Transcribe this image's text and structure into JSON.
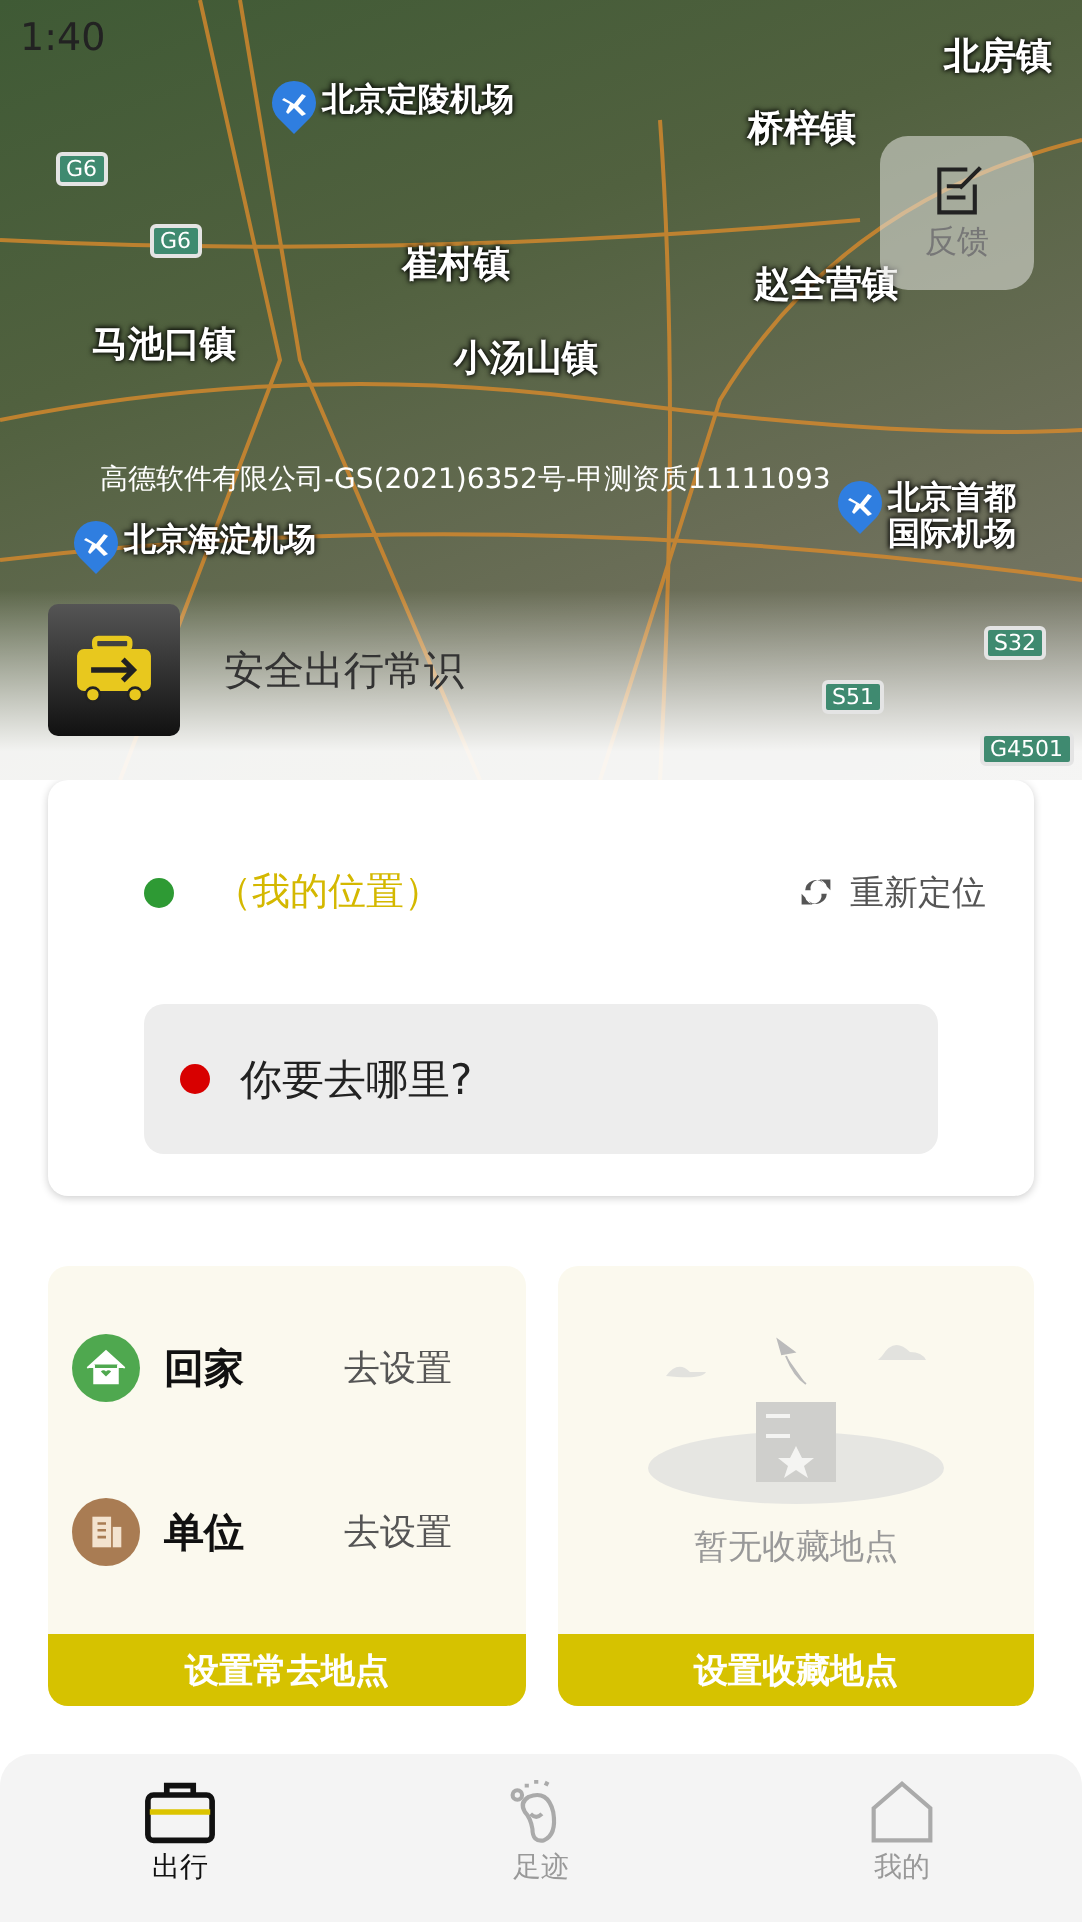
{
  "status_bar": {
    "time": "1:40"
  },
  "map": {
    "labels": [
      {
        "text": "北房镇",
        "kind": "place"
      },
      {
        "text": "北京定陵机场",
        "kind": "airport"
      },
      {
        "text": "桥梓镇",
        "kind": "place"
      },
      {
        "text": "G6",
        "kind": "road"
      },
      {
        "text": "G6",
        "kind": "road"
      },
      {
        "text": "崔村镇",
        "kind": "place"
      },
      {
        "text": "赵全营镇",
        "kind": "place"
      },
      {
        "text": "马池口镇",
        "kind": "place"
      },
      {
        "text": "小汤山镇",
        "kind": "place"
      },
      {
        "text": "北京海淀机场",
        "kind": "airport"
      },
      {
        "text": "北京首都国际机场",
        "kind": "airport"
      },
      {
        "text": "S32",
        "kind": "road"
      },
      {
        "text": "S51",
        "kind": "road"
      },
      {
        "text": "G4501",
        "kind": "road"
      }
    ],
    "copyright": "高德软件有限公司-GS(2021)6352号-甲测资质11111093"
  },
  "feedback_button": {
    "label": "反馈"
  },
  "safety_banner": {
    "label": "安全出行常识"
  },
  "route_card": {
    "origin": {
      "label": "（我的位置）",
      "color": "#2e9a34"
    },
    "relocate_button": {
      "label": "重新定位"
    },
    "destination": {
      "placeholder": "你要去哪里?",
      "color": "#d80000"
    }
  },
  "frequent_places": {
    "items": [
      {
        "label": "回家",
        "action": "去设置",
        "kind": "home"
      },
      {
        "label": "单位",
        "action": "去设置",
        "kind": "work"
      }
    ],
    "button": "设置常去地点"
  },
  "favorites": {
    "empty_text": "暂无收藏地点",
    "button": "设置收藏地点"
  },
  "tab_bar": [
    {
      "label": "出行",
      "kind": "travel",
      "selected": true
    },
    {
      "label": "足迹",
      "kind": "footprint",
      "selected": false
    },
    {
      "label": "我的",
      "kind": "mine",
      "selected": false
    }
  ]
}
